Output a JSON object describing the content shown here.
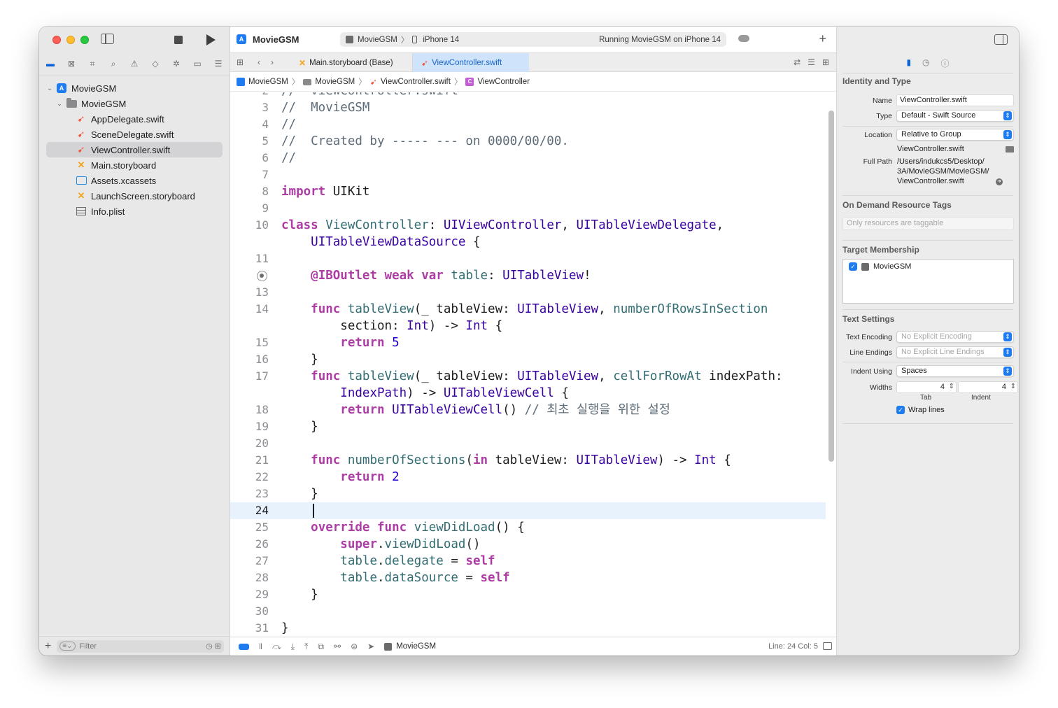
{
  "colors": {
    "accent": "#1f7cf0",
    "swift": "#f05138",
    "keyword": "#ad3da4",
    "type": "#3900a0",
    "selection_tab": "#cfe3fb",
    "current_line": "#e8f2fd"
  },
  "toolbar": {
    "app_title": "MovieGSM",
    "scheme": "MovieGSM",
    "device": "iPhone 14",
    "status": "Running MovieGSM on iPhone 14",
    "add_icon": "plus-icon"
  },
  "tabs": [
    {
      "label": "Main.storyboard (Base)",
      "icon": "storyboard-icon"
    },
    {
      "label": "ViewController.swift",
      "icon": "swift-icon"
    }
  ],
  "jumpbar": [
    "MovieGSM",
    "MovieGSM",
    "ViewController.swift",
    "ViewController"
  ],
  "navigator": {
    "tree": [
      {
        "label": "MovieGSM",
        "type": "project"
      },
      {
        "label": "MovieGSM",
        "type": "folder"
      },
      {
        "label": "AppDelegate.swift",
        "type": "swift"
      },
      {
        "label": "SceneDelegate.swift",
        "type": "swift"
      },
      {
        "label": "ViewController.swift",
        "type": "swift",
        "selected": true
      },
      {
        "label": "Main.storyboard",
        "type": "storyboard"
      },
      {
        "label": "Assets.xcassets",
        "type": "assets"
      },
      {
        "label": "LaunchScreen.storyboard",
        "type": "storyboard"
      },
      {
        "label": "Info.plist",
        "type": "plist"
      }
    ],
    "filter_placeholder": "Filter"
  },
  "editor": {
    "current_line": "24",
    "lines": [
      {
        "n": "2",
        "html": "<span class='cm'>//  ViewController.swift</span>"
      },
      {
        "n": "3",
        "html": "<span class='cm'>//  MovieGSM</span>"
      },
      {
        "n": "4",
        "html": "<span class='cm'>//</span>"
      },
      {
        "n": "5",
        "html": "<span class='cm'>//  Created by ----- --- on 0000/00/00.</span>"
      },
      {
        "n": "6",
        "html": "<span class='cm'>//</span>"
      },
      {
        "n": "7",
        "html": ""
      },
      {
        "n": "8",
        "html": "<span class='kw'>import</span> UIKit"
      },
      {
        "n": "9",
        "html": ""
      },
      {
        "n": "10",
        "html": "<span class='kw'>class</span> <span class='fn'>ViewController</span>: <span class='ty'>UIViewController</span>, <span class='ty'>UITableViewDelegate</span>,"
      },
      {
        "n": "",
        "html": "    <span class='ty'>UITableViewDataSource</span> {"
      },
      {
        "n": "11",
        "html": ""
      },
      {
        "n": "12",
        "html": "    <span class='attr'>@IBOutlet</span> <span class='kw'>weak</span> <span class='kw'>var</span> <span class='fn'>table</span>: <span class='ty'>UITableView</span>!",
        "breakpoint": true
      },
      {
        "n": "13",
        "html": ""
      },
      {
        "n": "14",
        "html": "    <span class='kw'>func</span> <span class='fn'>tableView</span>(_ tableView: <span class='ty'>UITableView</span>, <span class='fn'>numberOfRowsInSection</span>"
      },
      {
        "n": "",
        "html": "        section: <span class='ty'>Int</span>) -> <span class='ty'>Int</span> {"
      },
      {
        "n": "15",
        "html": "        <span class='kw'>return</span> <span class='nm'>5</span>"
      },
      {
        "n": "16",
        "html": "    }"
      },
      {
        "n": "17",
        "html": "    <span class='kw'>func</span> <span class='fn'>tableView</span>(_ tableView: <span class='ty'>UITableView</span>, <span class='fn'>cellForRowAt</span> indexPath:"
      },
      {
        "n": "",
        "html": "        <span class='ty'>IndexPath</span>) -> <span class='ty'>UITableViewCell</span> {"
      },
      {
        "n": "18",
        "html": "        <span class='kw'>return</span> <span class='ty'>UITableViewCell</span>() <span class='cm'>// 최초 실행을 위한 설정</span>"
      },
      {
        "n": "19",
        "html": "    }"
      },
      {
        "n": "20",
        "html": ""
      },
      {
        "n": "21",
        "html": "    <span class='kw'>func</span> <span class='fn'>numberOfSections</span>(<span class='kw'>in</span> tableView: <span class='ty'>UITableView</span>) -> <span class='ty'>Int</span> {"
      },
      {
        "n": "22",
        "html": "        <span class='kw'>return</span> <span class='nm'>2</span>"
      },
      {
        "n": "23",
        "html": "    }"
      },
      {
        "n": "24",
        "html": "    ",
        "current": true
      },
      {
        "n": "25",
        "html": "    <span class='kw'>override</span> <span class='kw'>func</span> <span class='fn'>viewDidLoad</span>() {"
      },
      {
        "n": "26",
        "html": "        <span class='kw'>super</span>.<span class='fn'>viewDidLoad</span>()"
      },
      {
        "n": "27",
        "html": "        <span class='fn'>table</span>.<span class='fn'>delegate</span> = <span class='kw'>self</span>"
      },
      {
        "n": "28",
        "html": "        <span class='fn'>table</span>.<span class='fn'>dataSource</span> = <span class='kw'>self</span>"
      },
      {
        "n": "29",
        "html": "    }"
      },
      {
        "n": "30",
        "html": ""
      },
      {
        "n": "31",
        "html": "}"
      }
    ]
  },
  "debugbar": {
    "scheme": "MovieGSM",
    "position": "Line: 24  Col: 5"
  },
  "inspector": {
    "identity_title": "Identity and Type",
    "name_label": "Name",
    "name_value": "ViewController.swift",
    "type_label": "Type",
    "type_value": "Default - Swift Source",
    "location_label": "Location",
    "location_value": "Relative to Group",
    "location_file": "ViewController.swift",
    "fullpath_label": "Full Path",
    "fullpath_1": "/Users/indukcs5/Desktop/",
    "fullpath_2": "3A/MovieGSM/MovieGSM/",
    "fullpath_3": "ViewController.swift",
    "ondemand_title": "On Demand Resource Tags",
    "ondemand_placeholder": "Only resources are taggable",
    "target_title": "Target Membership",
    "target_name": "MovieGSM",
    "text_title": "Text Settings",
    "encoding_label": "Text Encoding",
    "encoding_value": "No Explicit Encoding",
    "endings_label": "Line Endings",
    "endings_value": "No Explicit Line Endings",
    "indent_label": "Indent Using",
    "indent_value": "Spaces",
    "widths_label": "Widths",
    "tab_value": "4",
    "indent_width_value": "4",
    "tab_label": "Tab",
    "indent_sub_label": "Indent",
    "wrap_label": "Wrap lines"
  }
}
